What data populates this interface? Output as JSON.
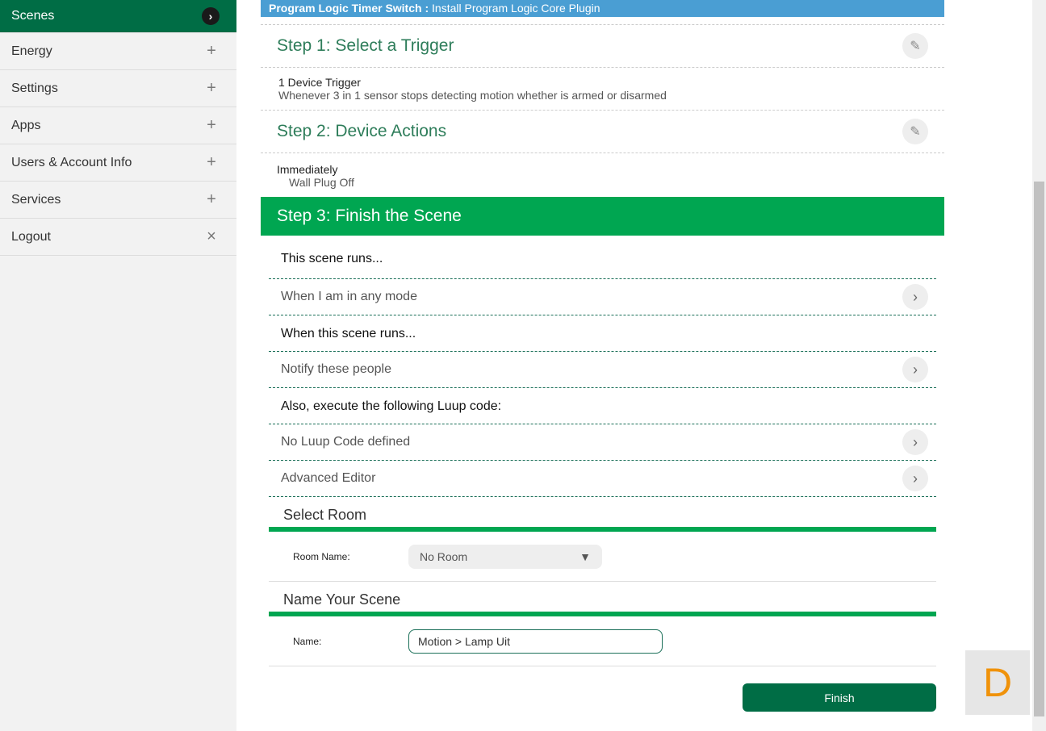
{
  "sidebar": {
    "items": [
      {
        "label": "Scenes",
        "icon": "›"
      },
      {
        "label": "Energy",
        "icon": "+"
      },
      {
        "label": "Settings",
        "icon": "+"
      },
      {
        "label": "Apps",
        "icon": "+"
      },
      {
        "label": "Users & Account Info",
        "icon": "+"
      },
      {
        "label": "Services",
        "icon": "+"
      },
      {
        "label": "Logout",
        "icon": "×"
      }
    ]
  },
  "banner": {
    "title": "Program Logic Timer Switch :",
    "text": " Install Program Logic Core Plugin"
  },
  "step1": {
    "title": "Step 1: Select a Trigger",
    "trigger": "1 Device Trigger",
    "desc": "Whenever 3 in 1 sensor stops detecting motion whether is armed or disarmed"
  },
  "step2": {
    "title": "Step 2: Device Actions",
    "when": "Immediately",
    "action": "Wall Plug Off"
  },
  "step3": {
    "title": "Step 3: Finish the Scene",
    "runs_label": "This scene runs...",
    "mode": "When I am in any mode",
    "when_label": "When this scene runs...",
    "notify": "Notify these people",
    "luup_label": "Also, execute the following Luup code:",
    "luup": "No Luup Code defined",
    "advanced": "Advanced Editor",
    "room_head": "Select Room",
    "room_label": "Room Name:",
    "room_value": "No Room",
    "name_head": "Name Your Scene",
    "name_label": "Name:",
    "name_value": "Motion > Lamp Uit",
    "finish": "Finish"
  },
  "badge": "D"
}
